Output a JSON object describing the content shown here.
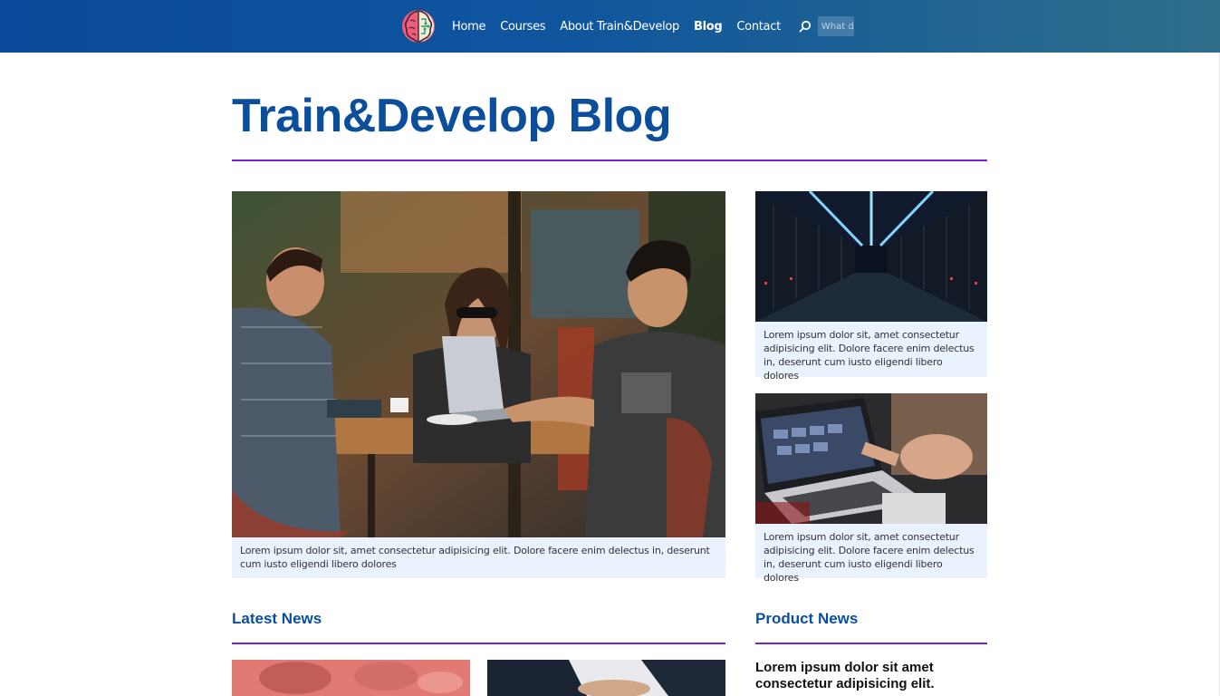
{
  "nav": {
    "logo_icon": "brain-logo-icon",
    "links": [
      {
        "label": "Home",
        "active": false
      },
      {
        "label": "Courses",
        "active": false
      },
      {
        "label": "About Train&Develop",
        "active": false
      },
      {
        "label": "Blog",
        "active": true
      },
      {
        "label": "Contact",
        "active": false
      }
    ],
    "search_icon": "search-icon",
    "search_placeholder": "What do"
  },
  "page": {
    "title": "Train&Develop Blog"
  },
  "featured": {
    "caption": "Lorem ipsum dolor sit, amet consectetur adipisicing elit. Dolore facere enim delectus in, deserunt cum iusto eligendi libero dolores"
  },
  "side_cards": [
    {
      "caption": "Lorem ipsum dolor sit, amet consectetur adipisicing elit. Dolore facere enim delectus in, deserunt cum iusto eligendi libero dolores"
    },
    {
      "caption": "Lorem ipsum dolor sit, amet consectetur adipisicing elit. Dolore facere enim delectus in, deserunt cum iusto eligendi libero dolores"
    }
  ],
  "sections": {
    "latest_news": "Latest News",
    "product_news": "Product News"
  },
  "product_news": {
    "headline": "Lorem ipsum dolor sit amet consectetur adipisicing elit."
  },
  "colors": {
    "brand_blue": "#0b4f9c",
    "accent_purple": "#7b1fd6",
    "caption_bg": "#eaf2ff"
  }
}
